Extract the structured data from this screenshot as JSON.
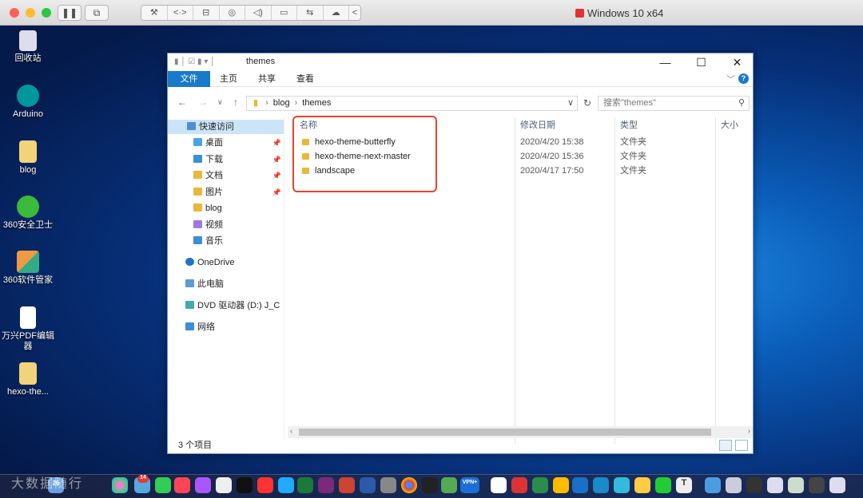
{
  "vm": {
    "title": "Windows 10 x64",
    "nav_glyphs": [
      "⚒",
      "<·>",
      "⊟",
      "◎",
      "◁)",
      "▭",
      "⇆",
      "☁",
      "<"
    ]
  },
  "desktop": {
    "icons": [
      "回收站",
      "Arduino",
      "blog",
      "360安全卫士",
      "360软件管家",
      "万兴PDF编辑器",
      "hexo-the..."
    ]
  },
  "explorer": {
    "title": "themes",
    "ribbon_tabs": [
      "文件",
      "主页",
      "共享",
      "查看"
    ],
    "address": {
      "crumbs": [
        "blog",
        "themes"
      ]
    },
    "search_placeholder": "搜索\"themes\"",
    "nav_items": [
      {
        "label": "快速访问",
        "icon": "star-icon",
        "pinned": false
      },
      {
        "label": "桌面",
        "icon": "desktop-folder-icon",
        "pinned": true
      },
      {
        "label": "下载",
        "icon": "download-folder-icon",
        "pinned": true
      },
      {
        "label": "文档",
        "icon": "documents-folder-icon",
        "pinned": true
      },
      {
        "label": "图片",
        "icon": "pictures-folder-icon",
        "pinned": true
      },
      {
        "label": "blog",
        "icon": "folder-icon",
        "pinned": false
      },
      {
        "label": "视频",
        "icon": "video-folder-icon",
        "pinned": false
      },
      {
        "label": "音乐",
        "icon": "music-folder-icon",
        "pinned": false
      },
      {
        "label": "OneDrive",
        "icon": "onedrive-icon",
        "pinned": false
      },
      {
        "label": "此电脑",
        "icon": "this-pc-icon",
        "pinned": false
      },
      {
        "label": "DVD 驱动器 (D:) J_C",
        "icon": "dvd-drive-icon",
        "pinned": false
      },
      {
        "label": "网络",
        "icon": "network-icon",
        "pinned": false
      }
    ],
    "columns": [
      "名称",
      "修改日期",
      "类型",
      "大小"
    ],
    "rows": [
      {
        "name": "hexo-theme-butterfly",
        "date": "2020/4/20 15:38",
        "type": "文件夹"
      },
      {
        "name": "hexo-theme-next-master",
        "date": "2020/4/20 15:36",
        "type": "文件夹"
      },
      {
        "name": "landscape",
        "date": "2020/4/17 17:50",
        "type": "文件夹"
      }
    ],
    "status": "3 个项目"
  },
  "dock": {
    "badges": [
      "26",
      "14",
      "VPN+",
      "T"
    ]
  },
  "watermark": "大数据随行",
  "colors": {
    "accent": "#1979ca",
    "highlight_box": "#e3452c",
    "selection": "#cce4f7",
    "folder": "#e9b73a"
  }
}
